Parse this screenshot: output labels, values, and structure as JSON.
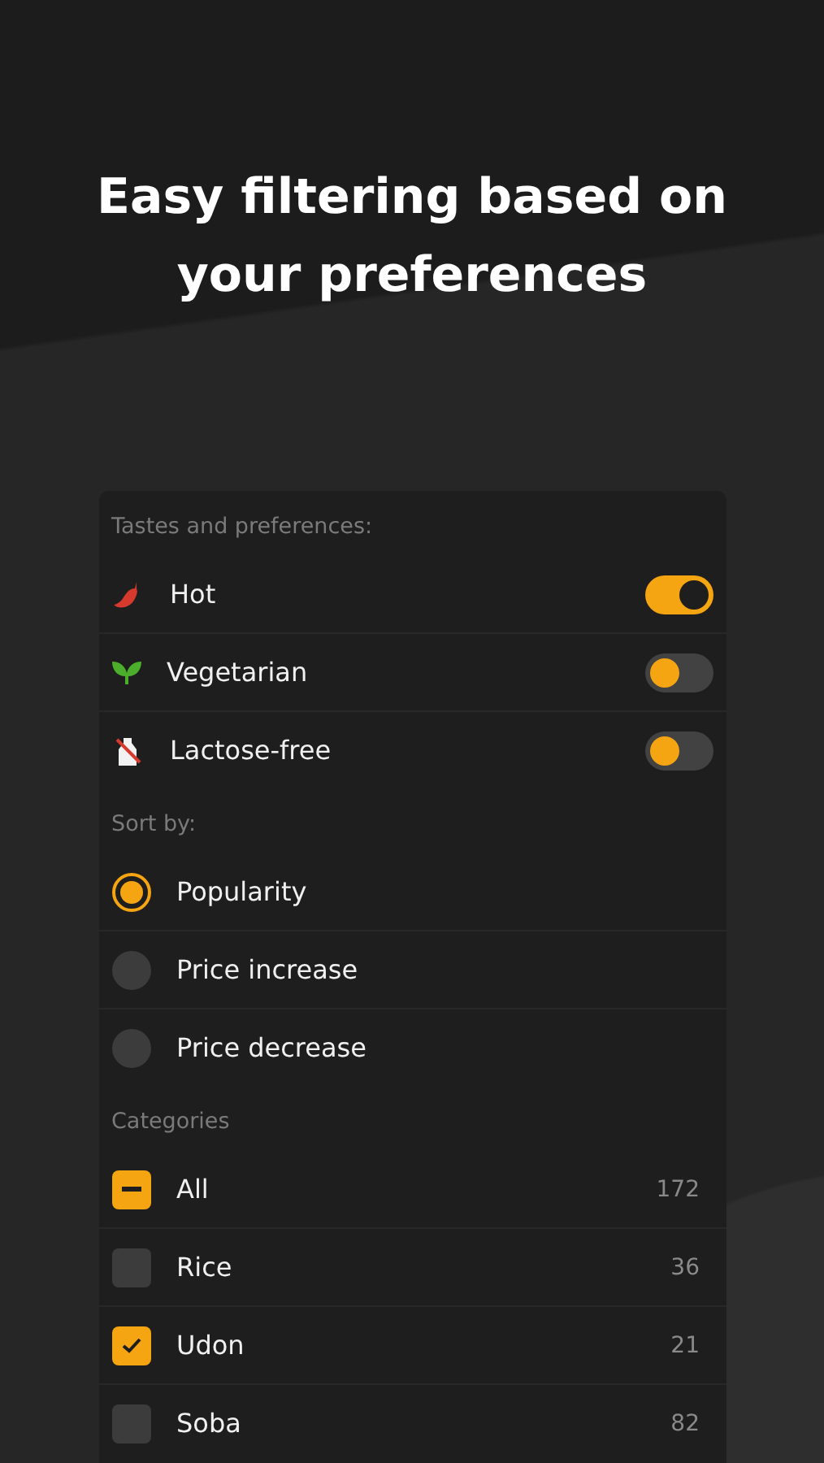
{
  "headline": "Easy filtering based on your preferences",
  "preferences": {
    "title": "Tastes and preferences:",
    "items": [
      {
        "label": "Hot",
        "on": true
      },
      {
        "label": "Vegetarian",
        "on": false
      },
      {
        "label": "Lactose-free",
        "on": false
      }
    ]
  },
  "sort": {
    "title": "Sort by:",
    "options": [
      {
        "label": "Popularity",
        "selected": true
      },
      {
        "label": "Price increase",
        "selected": false
      },
      {
        "label": "Price decrease",
        "selected": false
      }
    ]
  },
  "categories": {
    "title": "Categories",
    "items": [
      {
        "label": "All",
        "count": "172",
        "partial": true
      },
      {
        "label": "Rice",
        "count": "36",
        "checked": false
      },
      {
        "label": "Udon",
        "count": "21",
        "checked": true
      },
      {
        "label": "Soba",
        "count": "82",
        "checked": false
      }
    ]
  }
}
